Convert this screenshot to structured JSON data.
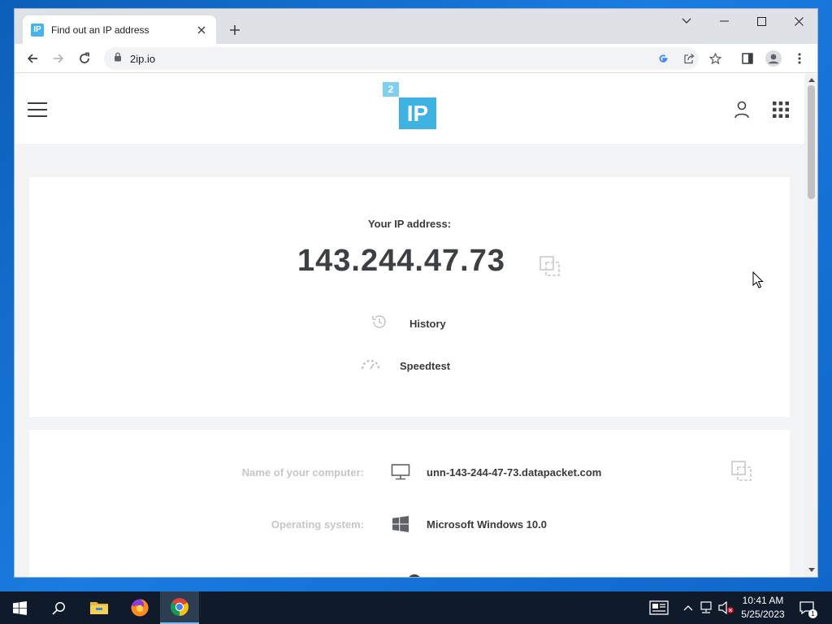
{
  "browser": {
    "tab": {
      "favicon_text": "IP",
      "title": "Find out an IP address"
    },
    "address_bar": {
      "url": "2ip.io"
    }
  },
  "site": {
    "logo": {
      "small": "2",
      "big": "IP"
    },
    "ip_section": {
      "label": "Your IP address:",
      "ip": "143.244.47.73",
      "history_label": "History",
      "speedtest_label": "Speedtest"
    },
    "details": [
      {
        "label": "Name of your computer:",
        "icon": "monitor-icon",
        "value": "unn-143-244-47-73.datapacket.com"
      },
      {
        "label": "Operating system:",
        "icon": "windows-logo-icon",
        "value": "Microsoft Windows 10.0"
      }
    ]
  },
  "taskbar": {
    "clock_time": "10:41 AM",
    "clock_date": "5/25/2023",
    "notification_count": "1"
  },
  "colors": {
    "accent": "#3fb2e4",
    "text_dark": "#3d4043",
    "label_muted": "#c4c6c9",
    "desktop": "#1a7be0"
  }
}
